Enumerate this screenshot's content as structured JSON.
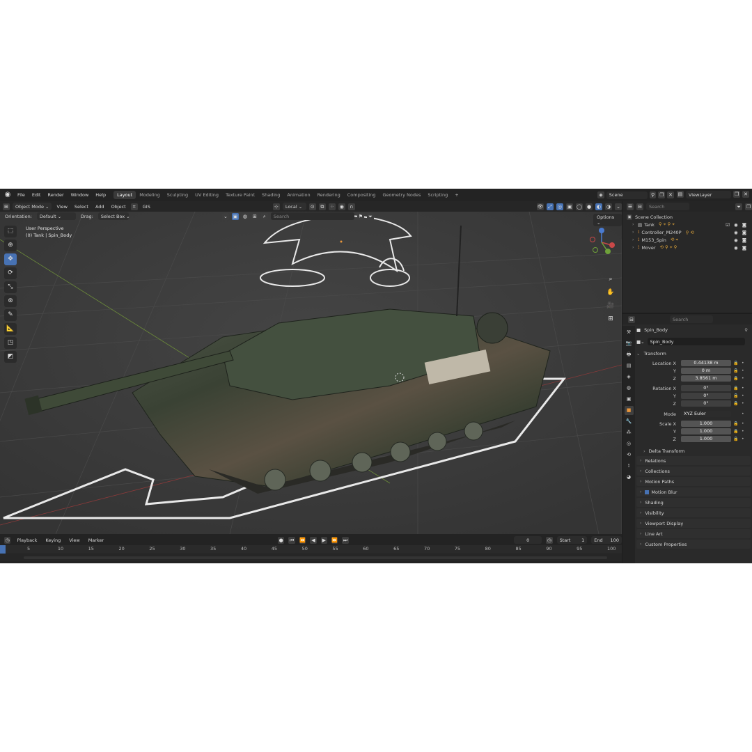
{
  "app": {
    "menus": [
      "File",
      "Edit",
      "Render",
      "Window",
      "Help"
    ],
    "workspaces": [
      "Layout",
      "Modeling",
      "Sculpting",
      "UV Editing",
      "Texture Paint",
      "Shading",
      "Animation",
      "Rendering",
      "Compositing",
      "Geometry Nodes",
      "Scripting"
    ],
    "active_workspace": "Layout",
    "scene": "Scene",
    "view_layer": "ViewLayer"
  },
  "viewport_header": {
    "mode": "Object Mode",
    "menus": [
      "View",
      "Select",
      "Add",
      "Object",
      "GIS"
    ],
    "transform_orientation": "Local",
    "orientation_label": "Orientation:",
    "orientation_value": "Default",
    "drag_label": "Drag:",
    "drag_value": "Select Box",
    "search_placeholder": "Search",
    "options": "Options"
  },
  "viewport": {
    "perspective": "User Perspective",
    "active_object": "(0) Tank | Spin_Body"
  },
  "timeline": {
    "menus": [
      "Playback",
      "Keying",
      "View",
      "Marker"
    ],
    "current_frame": "0",
    "start_label": "Start",
    "start": "1",
    "end_label": "End",
    "end": "100",
    "ticks": [
      5,
      10,
      15,
      20,
      25,
      30,
      35,
      40,
      45,
      50,
      55,
      60,
      65,
      70,
      75,
      80,
      85,
      90,
      95,
      100
    ]
  },
  "outliner": {
    "search_placeholder": "Search",
    "root": "Scene Collection",
    "items": [
      {
        "name": "Tank",
        "mods": "⚲ ⌖ ⚲ ⌖"
      },
      {
        "name": "Controller_M240P",
        "mods": "⚲ ⟲"
      },
      {
        "name": "M153_Spin",
        "mods": "⟲ ⌖"
      },
      {
        "name": "Mover",
        "mods": "⟲ ⚲ ⌖ ⚲"
      }
    ]
  },
  "properties": {
    "search_placeholder": "Search",
    "object_name": "Spin_Body",
    "object_field": "Spin_Body",
    "transform_header": "Transform",
    "location": [
      {
        "label": "Location X",
        "value": "0.44138 m"
      },
      {
        "label": "Y",
        "value": "0 m"
      },
      {
        "label": "Z",
        "value": "3.8561 m"
      }
    ],
    "rotation": [
      {
        "label": "Rotation X",
        "value": "0°"
      },
      {
        "label": "Y",
        "value": "0°"
      },
      {
        "label": "Z",
        "value": "0°"
      }
    ],
    "mode_label": "Mode",
    "mode_value": "XYZ Euler",
    "scale": [
      {
        "label": "Scale X",
        "value": "1.000"
      },
      {
        "label": "Y",
        "value": "1.000"
      },
      {
        "label": "Z",
        "value": "1.000"
      }
    ],
    "delta_transform": "Delta Transform",
    "panels": [
      "Relations",
      "Collections",
      "Motion Paths",
      "Motion Blur",
      "Shading",
      "Visibility",
      "Viewport Display",
      "Line Art",
      "Custom Properties"
    ]
  }
}
